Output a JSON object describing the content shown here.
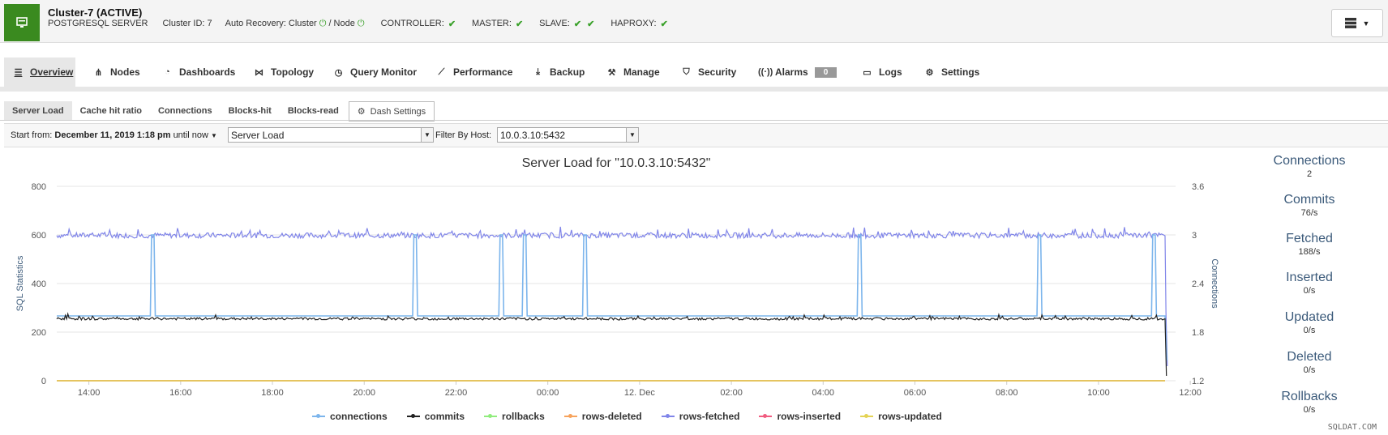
{
  "header": {
    "title": "Cluster-7 (ACTIVE)",
    "server_type": "POSTGRESQL SERVER",
    "cluster_id": "Cluster ID: 7",
    "auto_recovery_label": "Auto Recovery: Cluster",
    "auto_recovery_node": "/ Node",
    "controller": "CONTROLLER:",
    "master": "MASTER:",
    "slave": "SLAVE:",
    "haproxy": "HAPROXY:"
  },
  "tabs": [
    {
      "label": "Overview",
      "icon": "list-icon"
    },
    {
      "label": "Nodes",
      "icon": "nodes-icon"
    },
    {
      "label": "Dashboards",
      "icon": "dashboard-icon"
    },
    {
      "label": "Topology",
      "icon": "topology-icon"
    },
    {
      "label": "Query Monitor",
      "icon": "query-monitor-icon"
    },
    {
      "label": "Performance",
      "icon": "performance-icon"
    },
    {
      "label": "Backup",
      "icon": "backup-icon"
    },
    {
      "label": "Manage",
      "icon": "wrench-icon"
    },
    {
      "label": "Security",
      "icon": "shield-icon"
    },
    {
      "label": "Alarms",
      "icon": "alarm-icon",
      "badge": "0"
    },
    {
      "label": "Logs",
      "icon": "logs-icon"
    },
    {
      "label": "Settings",
      "icon": "gear-icon"
    }
  ],
  "subtabs": [
    "Server Load",
    "Cache hit ratio",
    "Connections",
    "Blocks-hit",
    "Blocks-read"
  ],
  "dash_settings": "Dash Settings",
  "filter": {
    "start_label": "Start from:",
    "start_value": "December 11, 2019 1:18 pm",
    "until": "until now",
    "dashboard_select": "Server Load",
    "host_label": "Filter By Host:",
    "host_select": "10.0.3.10:5432"
  },
  "stats": [
    {
      "name": "Connections",
      "value": "2"
    },
    {
      "name": "Commits",
      "value": "76/s"
    },
    {
      "name": "Fetched",
      "value": "188/s"
    },
    {
      "name": "Inserted",
      "value": "0/s"
    },
    {
      "name": "Updated",
      "value": "0/s"
    },
    {
      "name": "Deleted",
      "value": "0/s"
    },
    {
      "name": "Rollbacks",
      "value": "0/s"
    }
  ],
  "watermark": "SQLDAT.COM",
  "colors": {
    "connections": "#7cb5ec",
    "commits": "#222222",
    "rollbacks": "#90ed7d",
    "rows_deleted": "#f7a35c",
    "rows_fetched": "#8085e9",
    "rows_inserted": "#f15c80",
    "rows_updated": "#e4d354",
    "brand": "#3a8a1f"
  },
  "chart_data": {
    "type": "line",
    "title": "Server Load for \"10.0.3.10:5432\"",
    "ylabel": "SQL Statistics",
    "y2label": "Connections",
    "ylim": [
      0,
      800
    ],
    "y2lim": [
      1.2,
      3.6
    ],
    "yticks": [
      "0",
      "200",
      "400",
      "600",
      "800"
    ],
    "y2ticks": [
      "1.2",
      "1.8",
      "2.4",
      "3",
      "3.6"
    ],
    "xticks": [
      "14:00",
      "16:00",
      "18:00",
      "20:00",
      "22:00",
      "00:00",
      "12. Dec",
      "02:00",
      "04:00",
      "06:00",
      "08:00",
      "10:00",
      "12:00"
    ],
    "series": [
      {
        "name": "connections",
        "axis": "y2",
        "baseline": 2,
        "spikes": [
          [
            15.4,
            3
          ],
          [
            21.1,
            3
          ],
          [
            23.0,
            3
          ],
          [
            23.5,
            3
          ],
          [
            24.8,
            3
          ],
          [
            30.8,
            3
          ],
          [
            34.7,
            3
          ],
          [
            37.2,
            3
          ]
        ]
      },
      {
        "name": "commits",
        "axis": "y",
        "baseline": 255
      },
      {
        "name": "rollbacks",
        "axis": "y",
        "baseline": 0
      },
      {
        "name": "rows-deleted",
        "axis": "y",
        "baseline": 0
      },
      {
        "name": "rows-fetched",
        "axis": "y",
        "baseline": 598
      },
      {
        "name": "rows-inserted",
        "axis": "y",
        "baseline": 0
      },
      {
        "name": "rows-updated",
        "axis": "y",
        "baseline": 0
      }
    ]
  }
}
